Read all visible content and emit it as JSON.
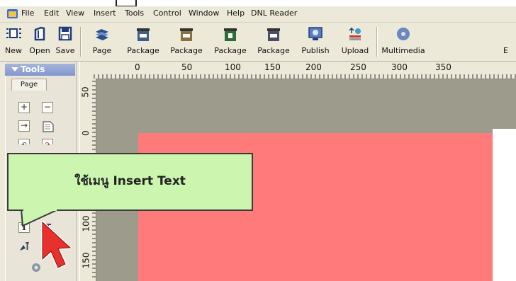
{
  "menu": {
    "items": [
      "File",
      "Edit",
      "View",
      "Insert",
      "Tools",
      "Control",
      "Window",
      "Help",
      "DNL Reader"
    ]
  },
  "toolbar": {
    "buttons": [
      "New",
      "Open",
      "Save",
      "Page",
      "Package",
      "Package",
      "Package",
      "Package",
      "Publish",
      "Upload",
      "Multimedia",
      "E"
    ]
  },
  "tools_panel": {
    "title": "Tools",
    "tab": "Page"
  },
  "ruler": {
    "h_marks": [
      "0",
      "50",
      "100",
      "150",
      "200",
      "250",
      "300",
      "350"
    ],
    "v_marks": [
      "50",
      "0",
      "100",
      "150"
    ]
  },
  "callout": {
    "text": "ใช้เมนู Insert Text"
  },
  "colors": {
    "canvas": "#9d9b8c",
    "page": "#ff7b7b",
    "callout_bg": "#ccf5b0",
    "cursor": "#e8312c"
  }
}
